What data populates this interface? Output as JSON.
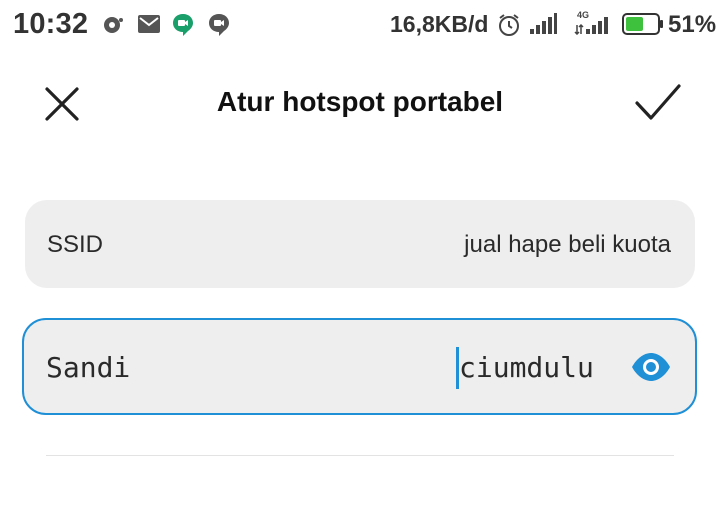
{
  "status_bar": {
    "time": "10:32",
    "net_speed": "16,8KB/d",
    "network_label": "4G",
    "battery_percent": "51%",
    "battery_color": "#3ec23e",
    "notification_icons": [
      "hotspot-icon",
      "mail-icon",
      "meet-icon",
      "chat-icon"
    ]
  },
  "header": {
    "title": "Atur hotspot portabel",
    "close_icon": "close-icon",
    "confirm_icon": "check-icon"
  },
  "form": {
    "ssid": {
      "label": "SSID",
      "value": "jual hape beli kuota"
    },
    "password": {
      "label": "Sandi",
      "value": "ciumdulu",
      "toggle_icon": "eye-icon"
    }
  },
  "colors": {
    "accent": "#1f8fd6",
    "field_bg": "#eeeeee"
  }
}
